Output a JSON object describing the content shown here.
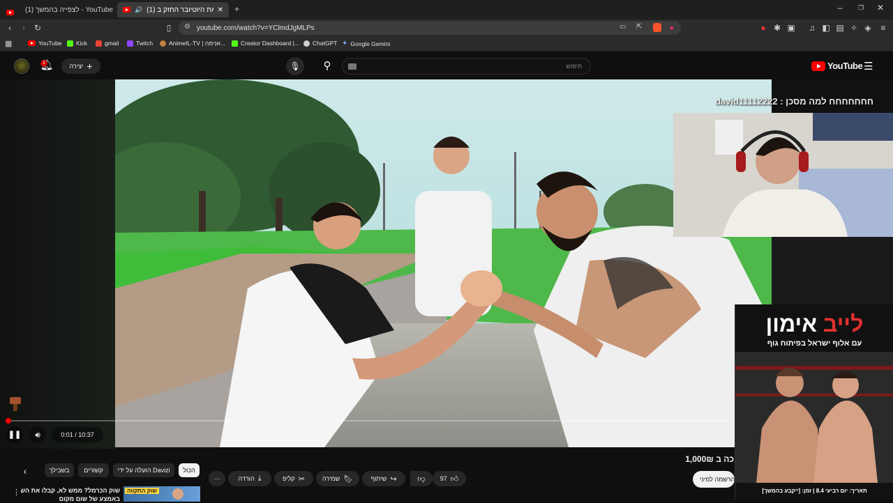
{
  "browser": {
    "tabs": [
      {
        "title": "(1) לצפייה בהמשך - YouTube"
      },
      {
        "title": "(1) תגובה את היוטיובר החזק ב"
      }
    ],
    "new_tab_label": "+",
    "url": "youtube.com/watch?v=YClmdJgMLPs",
    "bookmarks": [
      "YouTube",
      "Kick",
      "gmail",
      "Twitch",
      "AnimeIL-TV | אנימה...",
      "Creator Dashboard |...",
      "ChatGPT",
      "Google Gemini"
    ]
  },
  "youtube": {
    "logo_text": "YouTube",
    "search_placeholder": "חיפוש",
    "create_label": "יצירה",
    "notification_count": "1"
  },
  "stream": {
    "chat_message": "חחחחחחח למה מסכן : david11112222"
  },
  "ad": {
    "title_main": "אימון",
    "title_accent": "לייב",
    "subtitle": "עם אלוף ישראל בפיתוח גוף",
    "footer": "תאריך: יום רביעי 8.4 | זמן: [ייקבע בהמשך]"
  },
  "player": {
    "time_display": "0:01 / 10:37",
    "progress": 0.0016
  },
  "actions": {
    "price_text": "כה ב 1,000₪",
    "register_label": "הרשמה למיני",
    "like_count": "97",
    "share_label": "שיתוף",
    "save_label": "שמירה",
    "clip_label": "קליפ",
    "download_label": "הורדה",
    "more_label": "⋯"
  },
  "chips": [
    "הכול",
    "הועלה על ידי Davizi",
    "קשורים",
    "בשבילך"
  ],
  "recommendation": {
    "title": "שוק הכרמל? ממש לא, קבלו את השוק",
    "title_line2": "באמצע של שום מקום",
    "thumb_label": "שוק התקווה"
  },
  "colors": {
    "youtube_red": "#ff0000",
    "background": "#0f0f0f",
    "ad_accent": "#e0312e"
  }
}
